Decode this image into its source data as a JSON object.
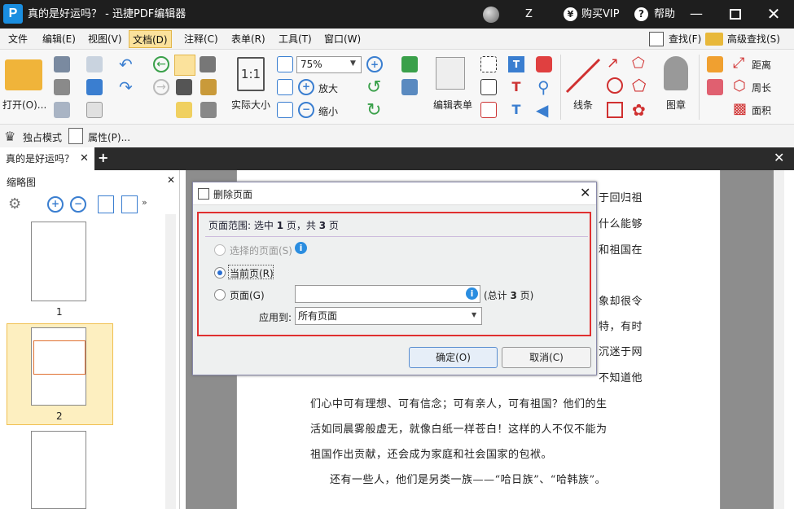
{
  "titlebar": {
    "logo": "P",
    "title": "真的是好运吗？ - 迅捷PDF编辑器",
    "user": "Z",
    "buy": "购买VIP",
    "help": "帮助"
  },
  "menu": [
    "文件",
    "编辑(E)",
    "视图(V)",
    "文档(D)",
    "注释(C)",
    "表单(R)",
    "工具(T)",
    "窗口(W)"
  ],
  "search": {
    "find": "查找(F)",
    "advanced": "高级查找(S)"
  },
  "ribbon": {
    "open": "打开(O)...",
    "actual_size": "实际大小",
    "zoom": "75%",
    "zoom_in": "放大",
    "zoom_out": "缩小",
    "edit_form": "编辑表单",
    "line": "线条",
    "stamp": "图章",
    "distance": "距离",
    "perimeter": "周长",
    "area": "面积"
  },
  "toolbar2": {
    "exclusive": "独占模式",
    "properties": "属性(P)..."
  },
  "tab": {
    "title": "真的是好运吗？"
  },
  "thumbs": {
    "title": "缩略图",
    "pages": [
      "1",
      "2"
    ]
  },
  "doc": {
    "right_lines": [
      "于回归祖",
      "什么能够",
      "和祖国在",
      "象却很令",
      "特，有时",
      "沉迷于网",
      "不知道他"
    ],
    "lines": [
      "们心中可有理想、可有信念；可有亲人，可有祖国？他们的生",
      "活如同晨雾般虚无，就像白纸一样苍白！这样的人不仅不能为",
      "祖国作出贡献，还会成为家庭和社会国家的包袱。",
      "还有一些人，他们是另类一族——“哈日族”、“哈韩族”。"
    ]
  },
  "dialog": {
    "title": "删除页面",
    "range_label": "页面范围: 选中 ",
    "range_sel": "1",
    "range_mid": " 页，共 ",
    "range_total": "3",
    "range_end": " 页",
    "opt_selected": "选择的页面(S)",
    "opt_current": "当前页(R)",
    "opt_pages": "页面(G)",
    "total_pre": "(总计 ",
    "total_num": "3",
    "total_post": " 页)",
    "apply_label": "应用到:",
    "apply_value": "所有页面",
    "ok": "确定(O)",
    "cancel": "取消(C)"
  },
  "colors": {
    "accent": "#1a8ee0",
    "highlight": "#fbe29c",
    "red": "#e03030"
  }
}
